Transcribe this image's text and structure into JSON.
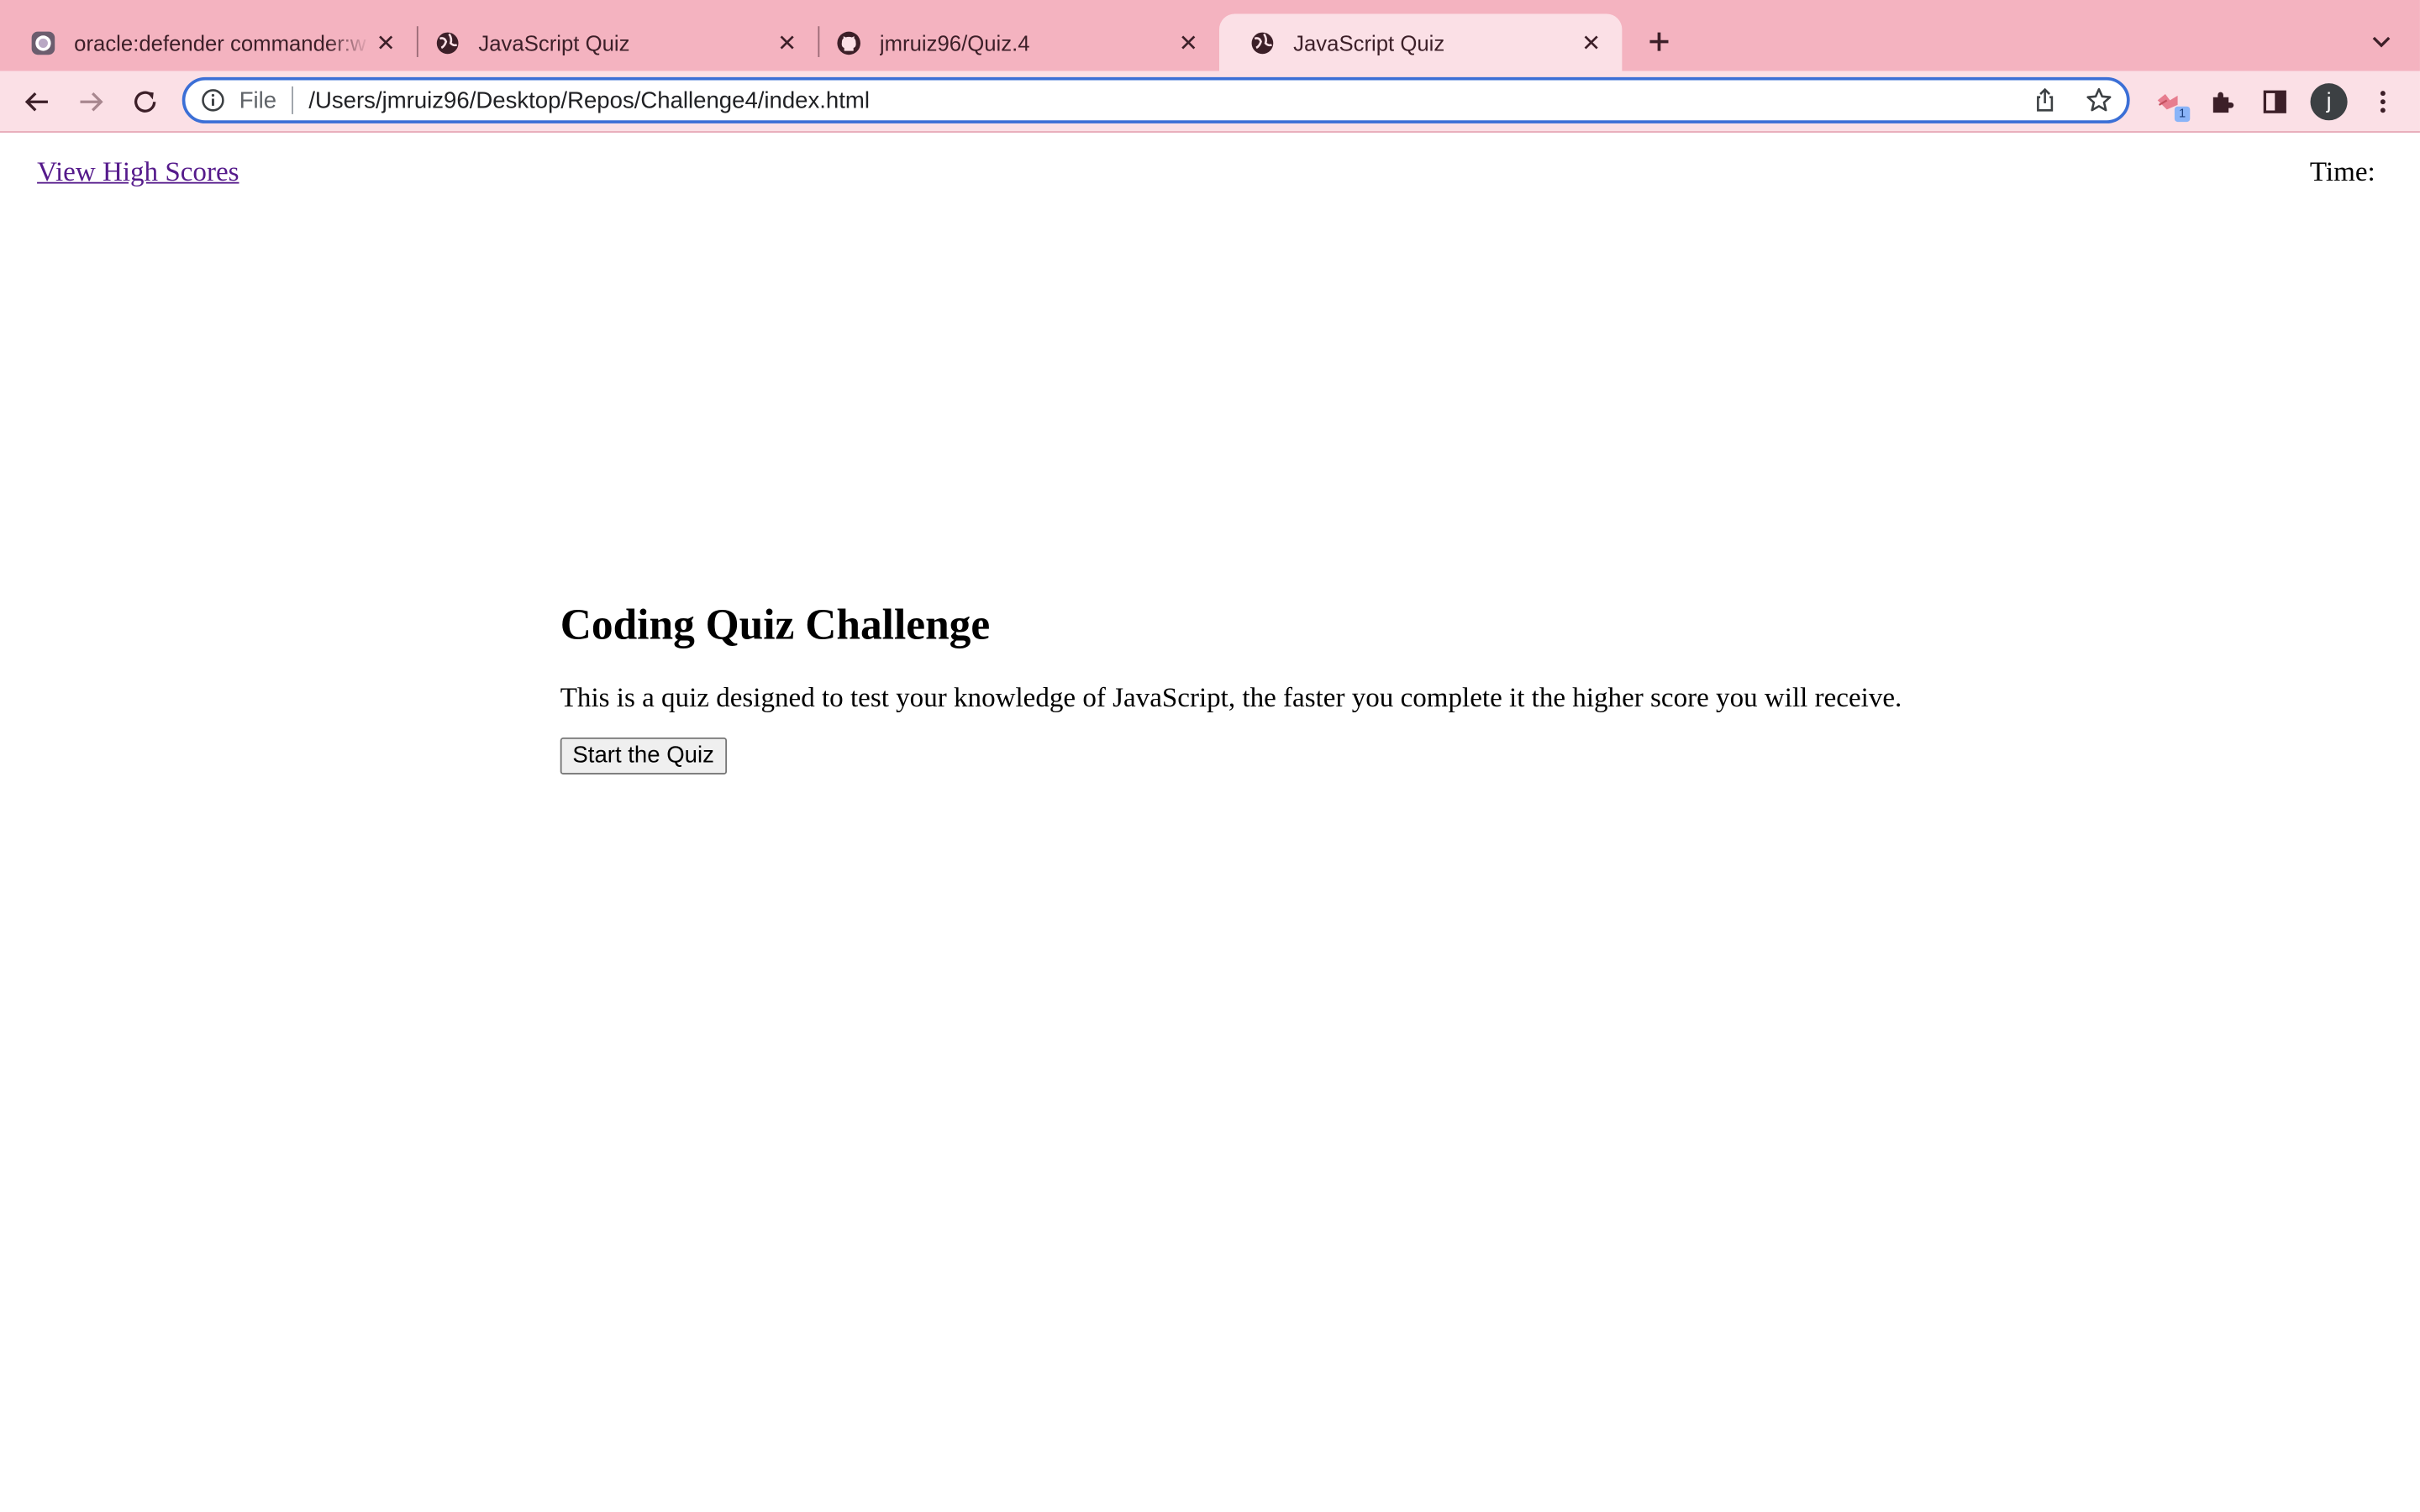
{
  "browser": {
    "tabs": [
      {
        "title": "oracle:defender commander:w",
        "icon": "oracle-favicon-icon",
        "active": false
      },
      {
        "title": "JavaScript Quiz",
        "icon": "globe-icon",
        "active": false
      },
      {
        "title": "jmruiz96/Quiz.4",
        "icon": "github-icon",
        "active": false
      },
      {
        "title": "JavaScript Quiz",
        "icon": "globe-icon",
        "active": true
      }
    ],
    "address_bar": {
      "scheme_label": "File",
      "url": "/Users/jmruiz96/Desktop/Repos/Challenge4/index.html"
    },
    "extension_badge": "1",
    "profile_initial": "j",
    "theme": {
      "tabstrip": "#f4b3c0",
      "toolbar": "#fbe0e6",
      "focus_ring": "#3b6fd6"
    }
  },
  "page": {
    "high_scores_link": "View High Scores",
    "timer_label": "Time:",
    "timer_value": "",
    "quiz": {
      "title": "Coding Quiz Challenge",
      "description": "This is a quiz designed to test your knowledge of JavaScript, the faster you complete it the higher score you will receive.",
      "start_button": "Start the Quiz"
    }
  }
}
